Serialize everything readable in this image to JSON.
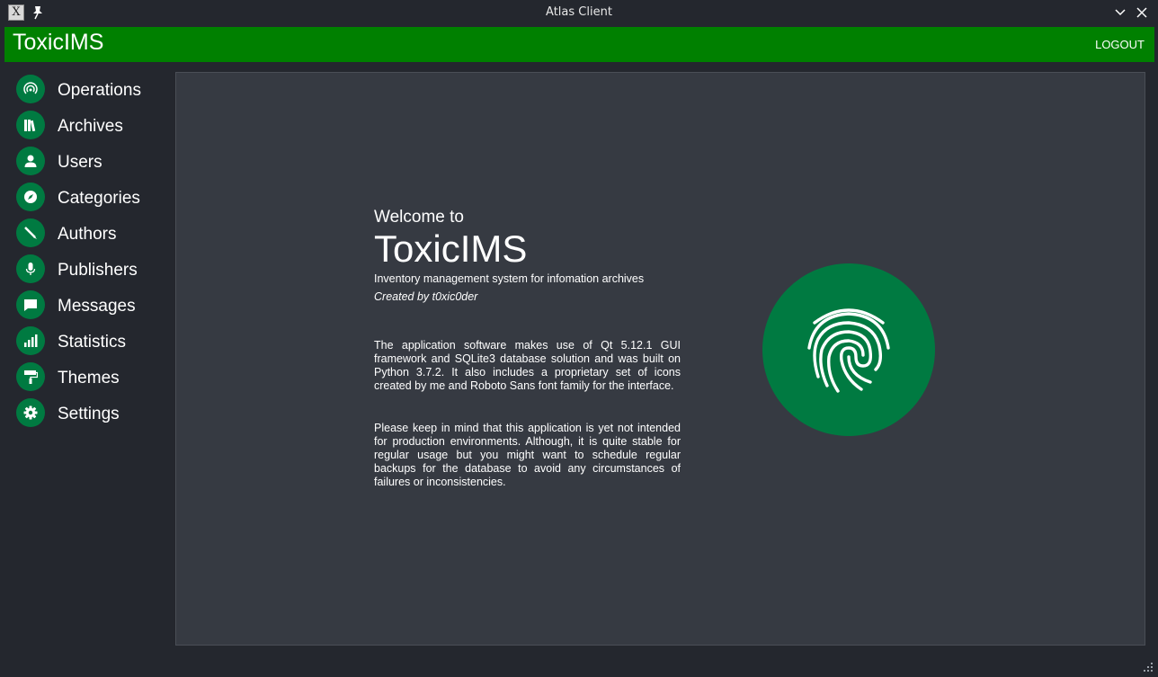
{
  "window": {
    "title": "Atlas Client",
    "app_icon": "X"
  },
  "header": {
    "brand": "ToxicIMS",
    "logout_label": "LOGOUT"
  },
  "sidebar": {
    "items": [
      {
        "label": "Operations",
        "icon": "radar-icon"
      },
      {
        "label": "Archives",
        "icon": "books-icon"
      },
      {
        "label": "Users",
        "icon": "user-icon"
      },
      {
        "label": "Categories",
        "icon": "compass-icon"
      },
      {
        "label": "Authors",
        "icon": "pen-icon"
      },
      {
        "label": "Publishers",
        "icon": "microphone-icon"
      },
      {
        "label": "Messages",
        "icon": "chat-icon"
      },
      {
        "label": "Statistics",
        "icon": "bar-chart-icon"
      },
      {
        "label": "Themes",
        "icon": "paint-roller-icon"
      },
      {
        "label": "Settings",
        "icon": "gear-icon"
      }
    ]
  },
  "main": {
    "welcome_small": "Welcome to",
    "welcome_big": "ToxicIMS",
    "subtitle": "Inventory management system for infomation archives",
    "author": "Created by t0xic0der",
    "paragraph1": "The application software makes use of Qt 5.12.1 GUI framework and SQLite3 database solution and was built on Python 3.7.2. It also includes a proprietary set of icons created by me and Roboto Sans font family for the interface.",
    "paragraph2": "Please keep in mind that this application is yet not intended for production environments. Although, it is quite stable for regular usage but you might want to schedule regular backups for the database to avoid any circumstances of failures or inconsistencies.",
    "logo_icon": "fingerprint-icon"
  },
  "colors": {
    "accent": "#008000",
    "icon_circle": "#007a41",
    "background": "#24272e",
    "panel": "#363a42"
  }
}
